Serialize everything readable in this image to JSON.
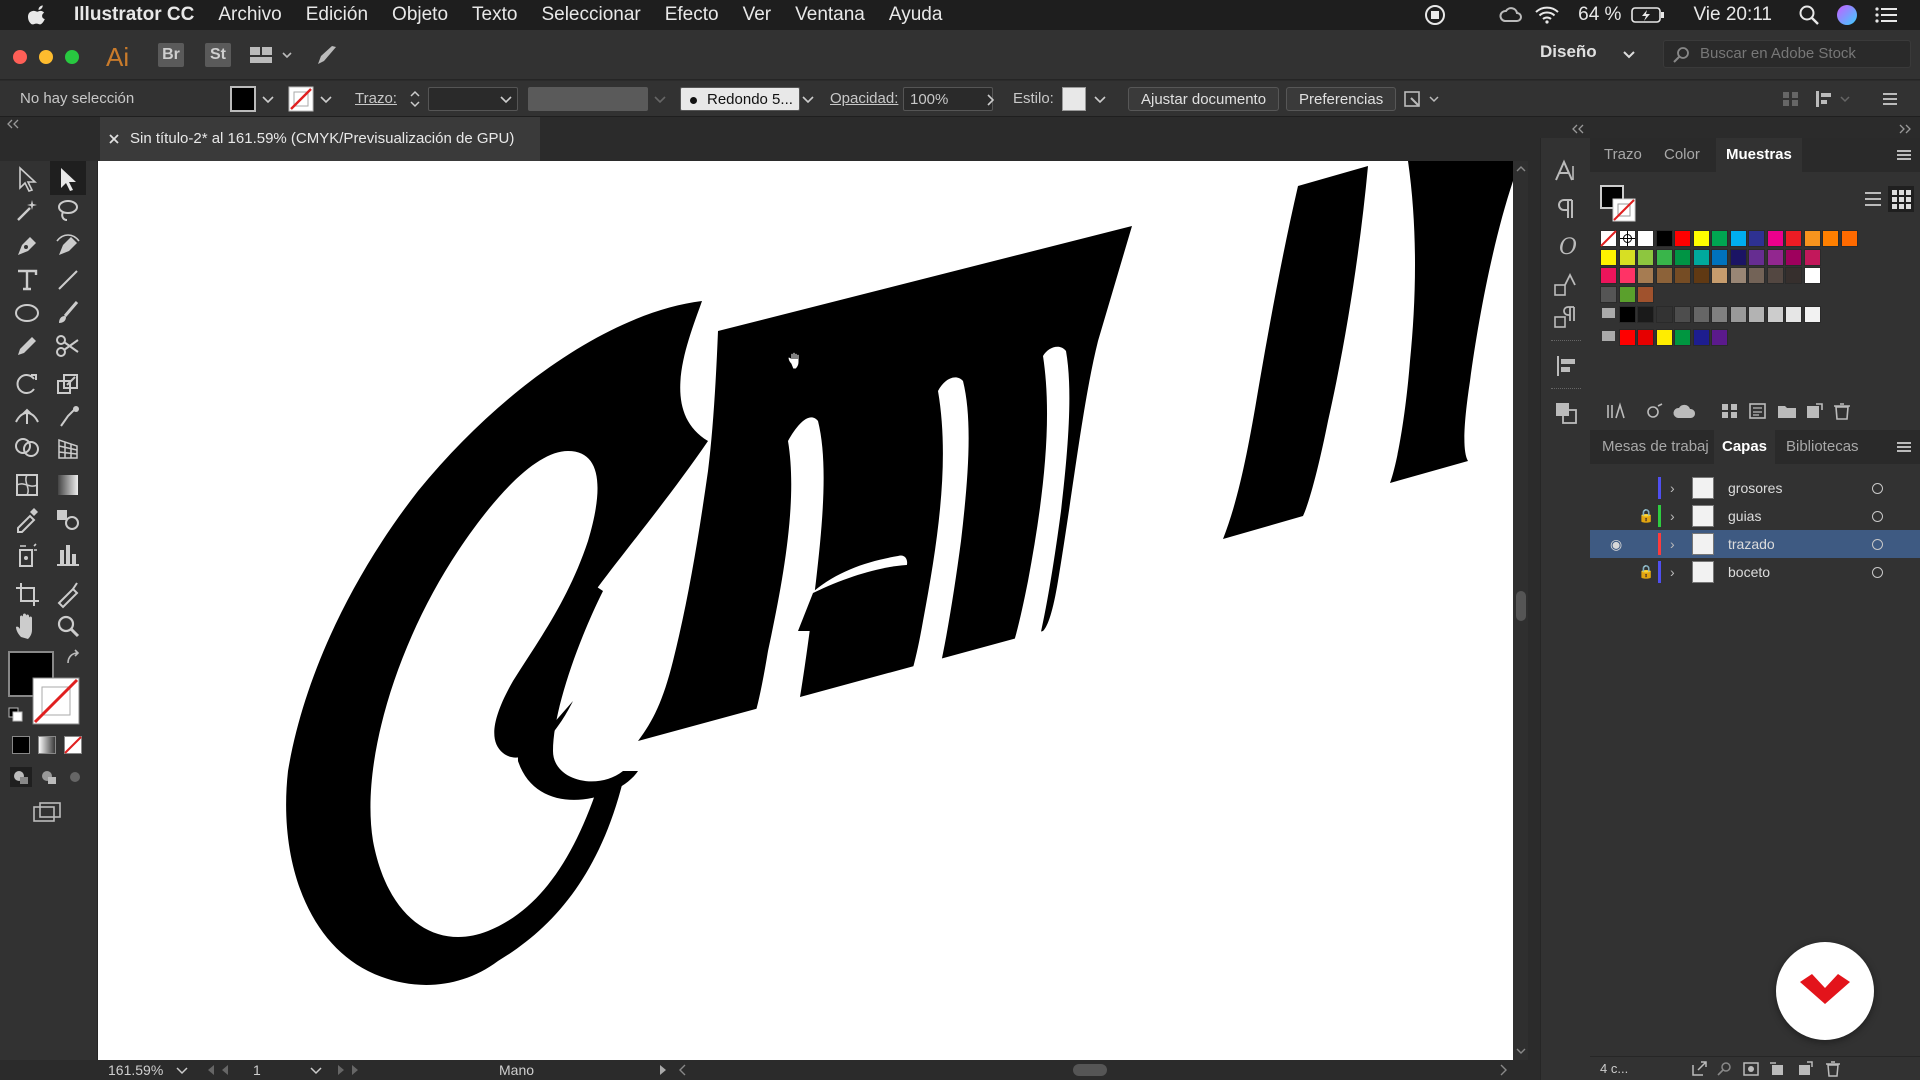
{
  "menubar": {
    "app_name": "Illustrator CC",
    "menus": [
      "Archivo",
      "Edición",
      "Objeto",
      "Texto",
      "Seleccionar",
      "Efecto",
      "Ver",
      "Ventana",
      "Ayuda"
    ],
    "battery": "64 %",
    "clock": "Vie 20:11"
  },
  "appbar": {
    "app_logo": "Ai",
    "bridge_label": "Br",
    "stock_label": "St",
    "workspace": "Diseño",
    "search_placeholder": "Buscar en Adobe Stock"
  },
  "controlbar": {
    "selection_status": "No hay selección",
    "stroke_label": "Trazo:",
    "brush_label": "Redondo 5...",
    "opacity_label": "Opacidad:",
    "opacity_value": "100%",
    "style_label": "Estilo:",
    "adjust_doc_button": "Ajustar documento",
    "prefs_button": "Preferencias"
  },
  "document": {
    "tab_title": "Sin título-2* al 161.59% (CMYK/Previsualización de GPU)"
  },
  "statusbar": {
    "zoom": "161.59%",
    "artboard_num": "1",
    "current_tool": "Mano"
  },
  "swatch_panel": {
    "tabs": [
      "Trazo",
      "Color",
      "Muestras"
    ],
    "active_tab": "Muestras",
    "row1": [
      "#ffffff",
      "#000000",
      "#ff0000",
      "#ffff00",
      "#00a651",
      "#00aeef",
      "#2e3192",
      "#ec008c",
      "#ed1c24",
      "#f7941d",
      "#ff7f00",
      "#ff6a00"
    ],
    "row2": [
      "#fff200",
      "#d7df23",
      "#8dc63f",
      "#39b54a",
      "#009444",
      "#00a99d",
      "#0072bc",
      "#1b1464",
      "#662d91",
      "#92278f",
      "#9e005d",
      "#c2185b"
    ],
    "row3": [
      "#ed145b",
      "#ff3366",
      "#a67c52",
      "#8c6239",
      "#754c24",
      "#603913",
      "#c69c6d",
      "#998675",
      "#736357",
      "#534741",
      "#362f2d",
      "#ffffff"
    ],
    "grays": [
      "#000000",
      "#1a1a1a",
      "#333333",
      "#4d4d4d",
      "#666666",
      "#808080",
      "#999999",
      "#b3b3b3",
      "#cccccc",
      "#e6e6e6",
      "#f2f2f2"
    ],
    "group2": [
      "#ff0000",
      "#e60000",
      "#ffed00",
      "#009640",
      "#1d1d8f",
      "#5b1a8c"
    ]
  },
  "layers_panel": {
    "tabs": [
      "Mesas de trabajo",
      "Capas",
      "Bibliotecas"
    ],
    "active_tab": "Capas",
    "layers": [
      {
        "name": "grosores",
        "color": "#4f4ff0",
        "locked": false,
        "visible": false,
        "selected": false
      },
      {
        "name": "guias",
        "color": "#2ecc40",
        "locked": true,
        "visible": false,
        "selected": false
      },
      {
        "name": "trazado",
        "color": "#ff3b3b",
        "locked": false,
        "visible": true,
        "selected": true
      },
      {
        "name": "boceto",
        "color": "#4f4ff0",
        "locked": true,
        "visible": false,
        "selected": false
      }
    ],
    "count": "4 c..."
  }
}
